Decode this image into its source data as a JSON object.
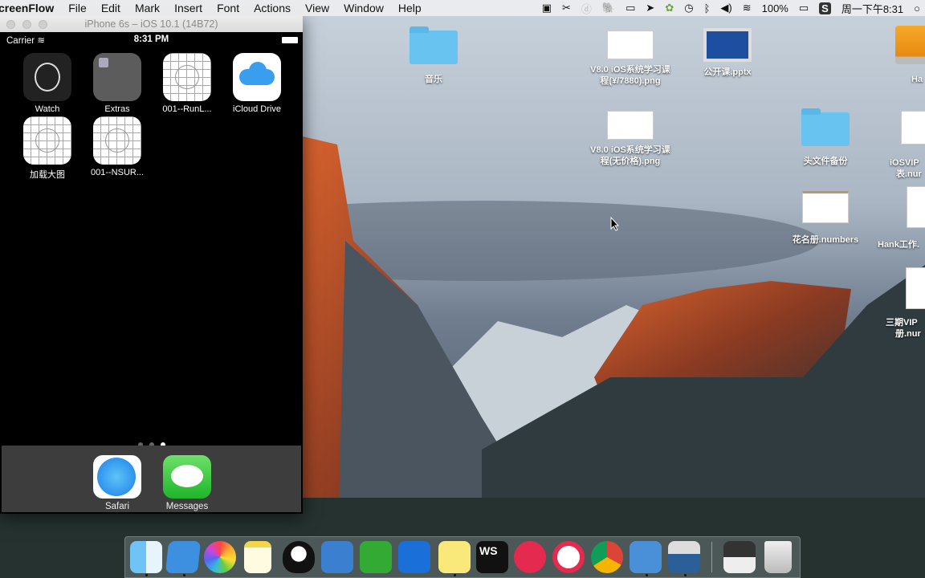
{
  "menubar": {
    "app": "creenFlow",
    "items": [
      "File",
      "Edit",
      "Mark",
      "Insert",
      "Font",
      "Actions",
      "View",
      "Window",
      "Help"
    ],
    "status": {
      "battery": "100%",
      "clock": "周一下午8:31",
      "icons": [
        "screenflow-camera-icon",
        "scissors-icon",
        "disc-icon",
        "evernote-icon",
        "airplay-display-icon",
        "send-icon",
        "frog-icon",
        "time-machine-icon",
        "bluetooth-icon",
        "volume-icon",
        "wifi-icon",
        "battery-icon",
        "sogou-input-icon",
        "search-icon"
      ]
    }
  },
  "simulator": {
    "title": "iPhone 6s – iOS 10.1 (14B72)",
    "status_bar": {
      "carrier": "Carrier",
      "time": "8:31 PM"
    },
    "apps": [
      {
        "label": "Watch",
        "icon": "watch-icon"
      },
      {
        "label": "Extras",
        "icon": "folder-icon"
      },
      {
        "label": "001--RunL...",
        "icon": "placeholder-app-icon"
      },
      {
        "label": "iCloud Drive",
        "icon": "icloud-icon"
      },
      {
        "label": "加载大图",
        "icon": "placeholder-app-icon"
      },
      {
        "label": "001--NSUR...",
        "icon": "placeholder-app-icon"
      }
    ],
    "page_dots": {
      "count": 3,
      "current": 3
    },
    "dock": [
      {
        "label": "Safari",
        "icon": "safari-icon"
      },
      {
        "label": "Messages",
        "icon": "messages-icon"
      }
    ]
  },
  "desktop": {
    "icons": [
      {
        "label": "音乐",
        "type": "folder"
      },
      {
        "label": "V8.0 iOS系统学习课",
        "label2": "程(¥/7880).png",
        "type": "image"
      },
      {
        "label": "公开课.pptx",
        "type": "pptx"
      },
      {
        "label": "Ha",
        "type": "drive"
      },
      {
        "label": "V8.0 iOS系统学习课",
        "label2": "程(无价格).png",
        "type": "image"
      },
      {
        "label": "头文件备份",
        "type": "folder"
      },
      {
        "label": "iOSVIP",
        "label2": "表.nur",
        "type": "numbers"
      },
      {
        "label": "花名册.numbers",
        "type": "numbers"
      },
      {
        "label": "Hank工作.",
        "type": "document"
      },
      {
        "label": "三期VIP",
        "label2": "册.nur",
        "type": "numbers"
      }
    ]
  },
  "dock": {
    "apps": [
      "finder",
      "xcode",
      "photos",
      "notes",
      "qq",
      "dictionary",
      "evernote",
      "teamviewer",
      "stickies",
      "webstorm",
      "flickr-like-app",
      "flickr-like-app-2",
      "chrome",
      "simulator",
      "screenflow",
      "file-manager",
      "trash"
    ]
  }
}
